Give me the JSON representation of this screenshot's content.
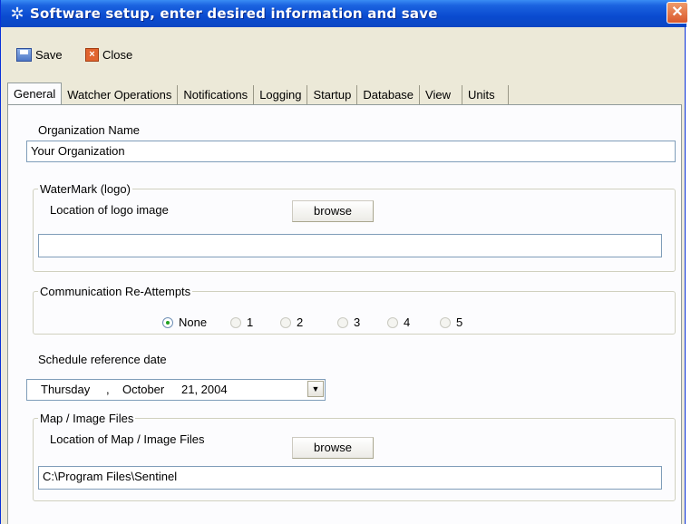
{
  "window": {
    "title": "Software setup, enter desired information and save"
  },
  "toolbar": {
    "save_label": "Save",
    "close_label": "Close"
  },
  "tabs": [
    {
      "label": "General",
      "active": true
    },
    {
      "label": "Watcher Operations",
      "active": false
    },
    {
      "label": "Notifications",
      "active": false
    },
    {
      "label": "Logging",
      "active": false
    },
    {
      "label": "Startup",
      "active": false
    },
    {
      "label": "Database",
      "active": false
    },
    {
      "label": "View",
      "active": false
    },
    {
      "label": "Units",
      "active": false
    }
  ],
  "general": {
    "org_label": "Organization Name",
    "org_value": "Your Organization",
    "watermark_group": "WaterMark (logo)",
    "logo_location_label": "Location of logo image",
    "logo_browse": "browse",
    "logo_path_value": "",
    "comm_group": "Communication Re-Attempts",
    "comm_options": [
      "None",
      "1",
      "2",
      "3",
      "4",
      "5"
    ],
    "comm_selected": "None",
    "schedule_label": "Schedule reference date",
    "date_weekday": "Thursday",
    "date_sep": ",",
    "date_month": "October",
    "date_day": "21, 2004",
    "map_group": "Map / Image Files",
    "map_location_label": "Location of Map / Image Files",
    "map_browse": "browse",
    "map_path_value": "C:\\Program Files\\Sentinel"
  },
  "colors": {
    "titlebar": "#0a4bd0",
    "dialog_bg": "#ece9d8",
    "panel_bg": "#fcfcfe",
    "radio_dot": "#21a121"
  }
}
